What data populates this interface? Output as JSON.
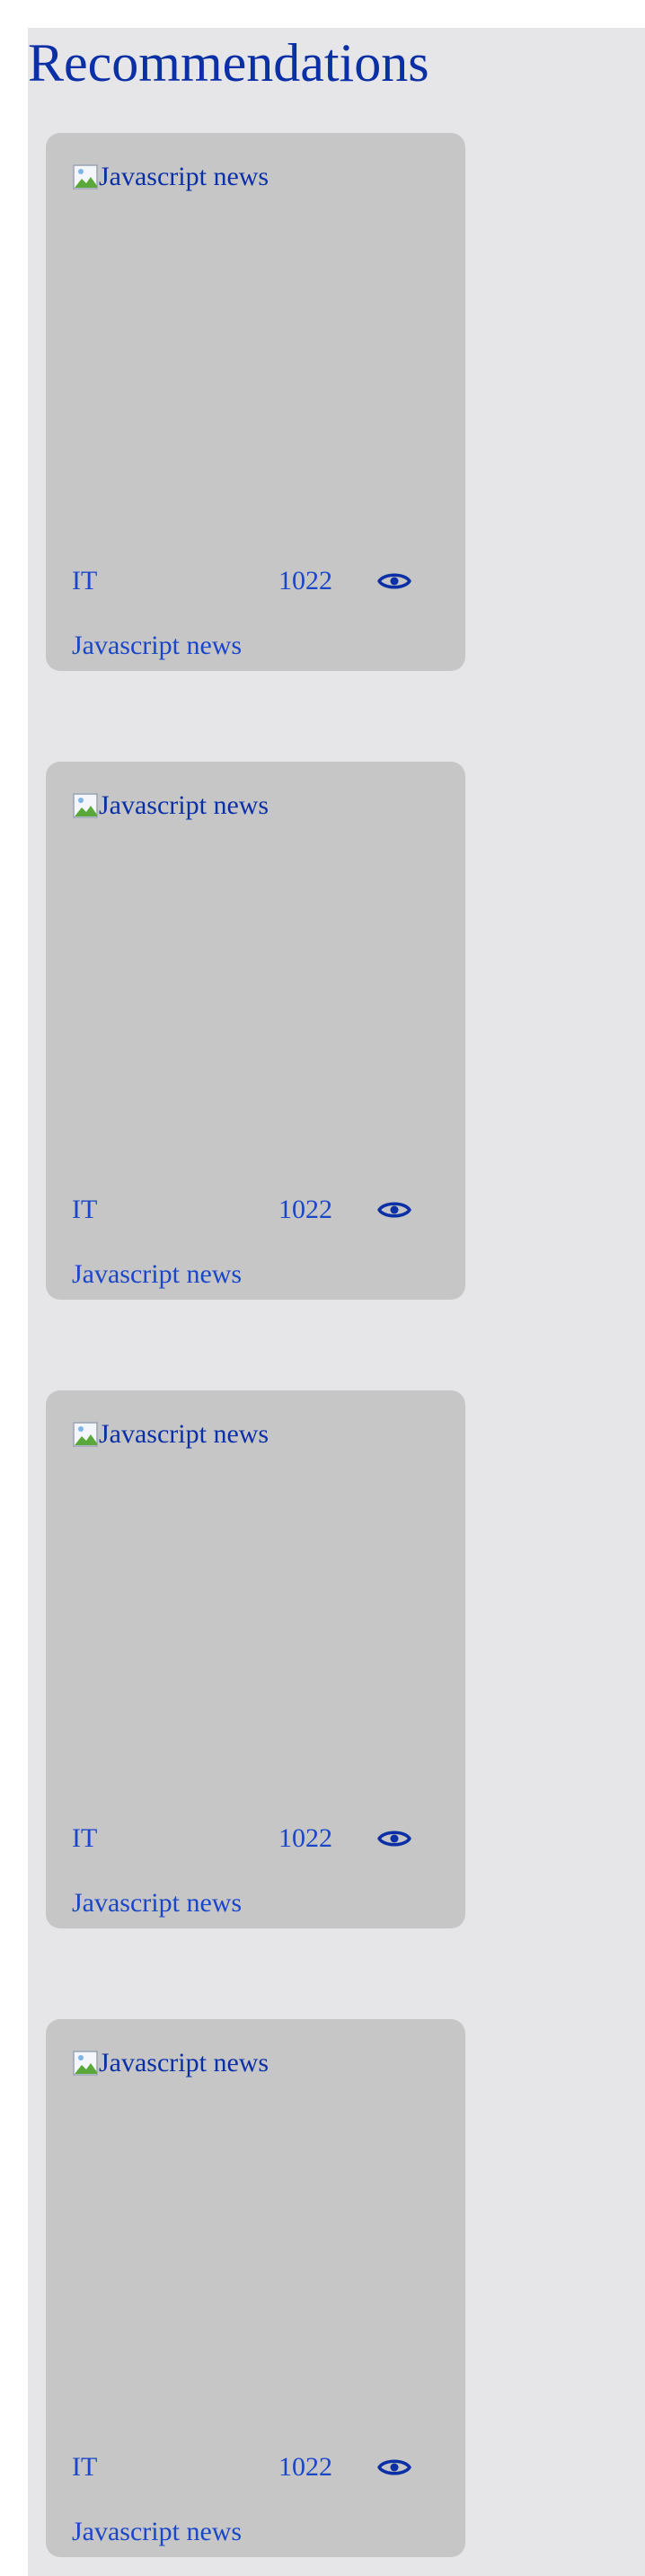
{
  "page": {
    "title": "Recommendations",
    "background": "#e6e6e9",
    "card_background": "#c6c6c6",
    "accent_color": "#0b2fa5"
  },
  "cards": [
    {
      "image_alt": "Javascript news",
      "category": "IT",
      "views": "1022",
      "views_icon": "eye-icon",
      "title": "Javascript news"
    },
    {
      "image_alt": "Javascript news",
      "category": "IT",
      "views": "1022",
      "views_icon": "eye-icon",
      "title": "Javascript news"
    },
    {
      "image_alt": "Javascript news",
      "category": "IT",
      "views": "1022",
      "views_icon": "eye-icon",
      "title": "Javascript news"
    },
    {
      "image_alt": "Javascript news",
      "category": "IT",
      "views": "1022",
      "views_icon": "eye-icon",
      "title": "Javascript news"
    }
  ]
}
